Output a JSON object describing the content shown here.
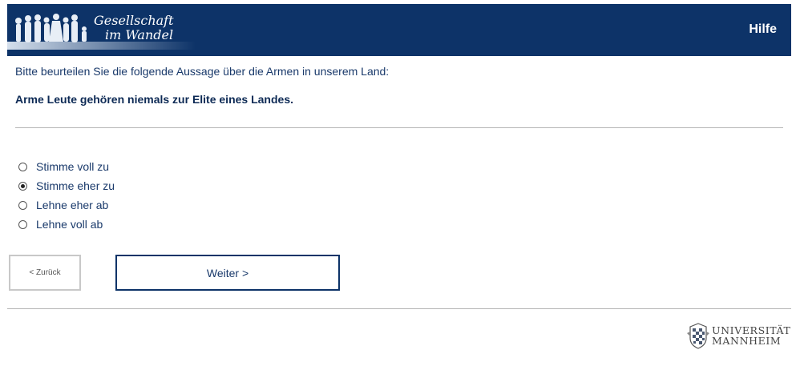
{
  "header": {
    "logo_line1": "Gesellschaft",
    "logo_line2": "im Wandel",
    "help_label": "Hilfe"
  },
  "question": {
    "intro": "Bitte beurteilen Sie die folgende Aussage über die Armen in unserem Land:",
    "statement": "Arme Leute gehören niemals zur Elite eines Landes."
  },
  "options": [
    {
      "label": "Stimme voll zu",
      "checked": false
    },
    {
      "label": "Stimme eher zu",
      "checked": true
    },
    {
      "label": "Lehne eher ab",
      "checked": false
    },
    {
      "label": "Lehne voll ab",
      "checked": false
    }
  ],
  "nav": {
    "back_label": "< Zurück",
    "next_label": "Weiter >"
  },
  "footer": {
    "university_line1": "UNIVERSITÄT",
    "university_line2": "MANNHEIM"
  },
  "colors": {
    "header_bg": "#0d3368",
    "text": "#1a3a6b"
  }
}
